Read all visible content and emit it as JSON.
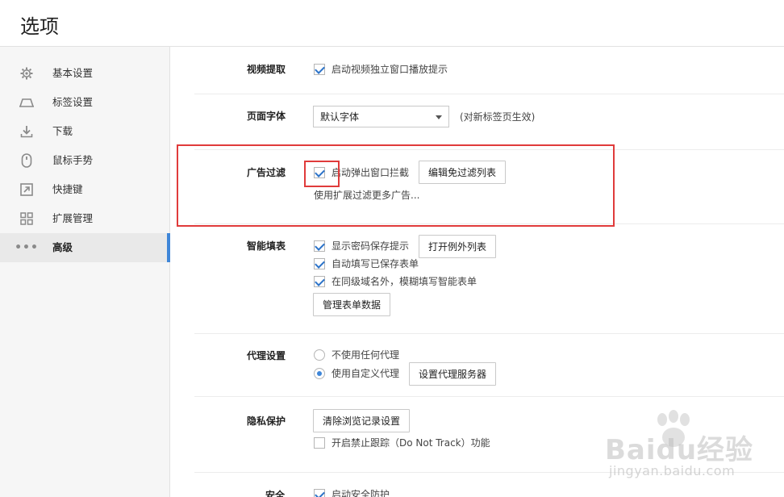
{
  "header": {
    "title": "选项"
  },
  "sidebar": {
    "items": [
      {
        "label": "基本设置",
        "icon": "gear-icon"
      },
      {
        "label": "标签设置",
        "icon": "tab-icon"
      },
      {
        "label": "下载",
        "icon": "download-icon"
      },
      {
        "label": "鼠标手势",
        "icon": "mouse-icon"
      },
      {
        "label": "快捷键",
        "icon": "shortcut-icon"
      },
      {
        "label": "扩展管理",
        "icon": "extensions-icon"
      },
      {
        "label": "高级",
        "icon": "more-dots-icon",
        "active": true
      }
    ]
  },
  "sections": {
    "video": {
      "label": "视频提取",
      "option": "启动视频独立窗口播放提示",
      "checked": true
    },
    "font": {
      "label": "页面字体",
      "selected": "默认字体",
      "note": "(对新标签页生效)"
    },
    "adfilter": {
      "label": "广告过滤",
      "option": "启动弹出窗口拦截",
      "checked": true,
      "button": "编辑免过滤列表",
      "link": "使用扩展过滤更多广告..."
    },
    "autofill": {
      "label": "智能填表",
      "options": [
        {
          "text": "显示密码保存提示",
          "checked": true
        },
        {
          "text": "自动填写已保存表单",
          "checked": true
        },
        {
          "text": "在同级域名外，模糊填写智能表单",
          "checked": true
        }
      ],
      "exceptions_button": "打开例外列表",
      "manage_button": "管理表单数据"
    },
    "proxy": {
      "label": "代理设置",
      "options": [
        {
          "text": "不使用任何代理",
          "checked": false
        },
        {
          "text": "使用自定义代理",
          "checked": true
        }
      ],
      "button": "设置代理服务器"
    },
    "privacy": {
      "label": "隐私保护",
      "button": "清除浏览记录设置",
      "option": "开启禁止跟踪（Do Not Track）功能",
      "checked": false
    },
    "security": {
      "label": "安全",
      "option": "启动安全防护",
      "checked": true
    }
  },
  "watermark": {
    "brand": "Baidu经验",
    "url": "jingyan.baidu.com"
  },
  "colors": {
    "accent": "#3f86d8",
    "highlight": "#e03b3b",
    "sidebar_bg": "#f6f6f6"
  }
}
